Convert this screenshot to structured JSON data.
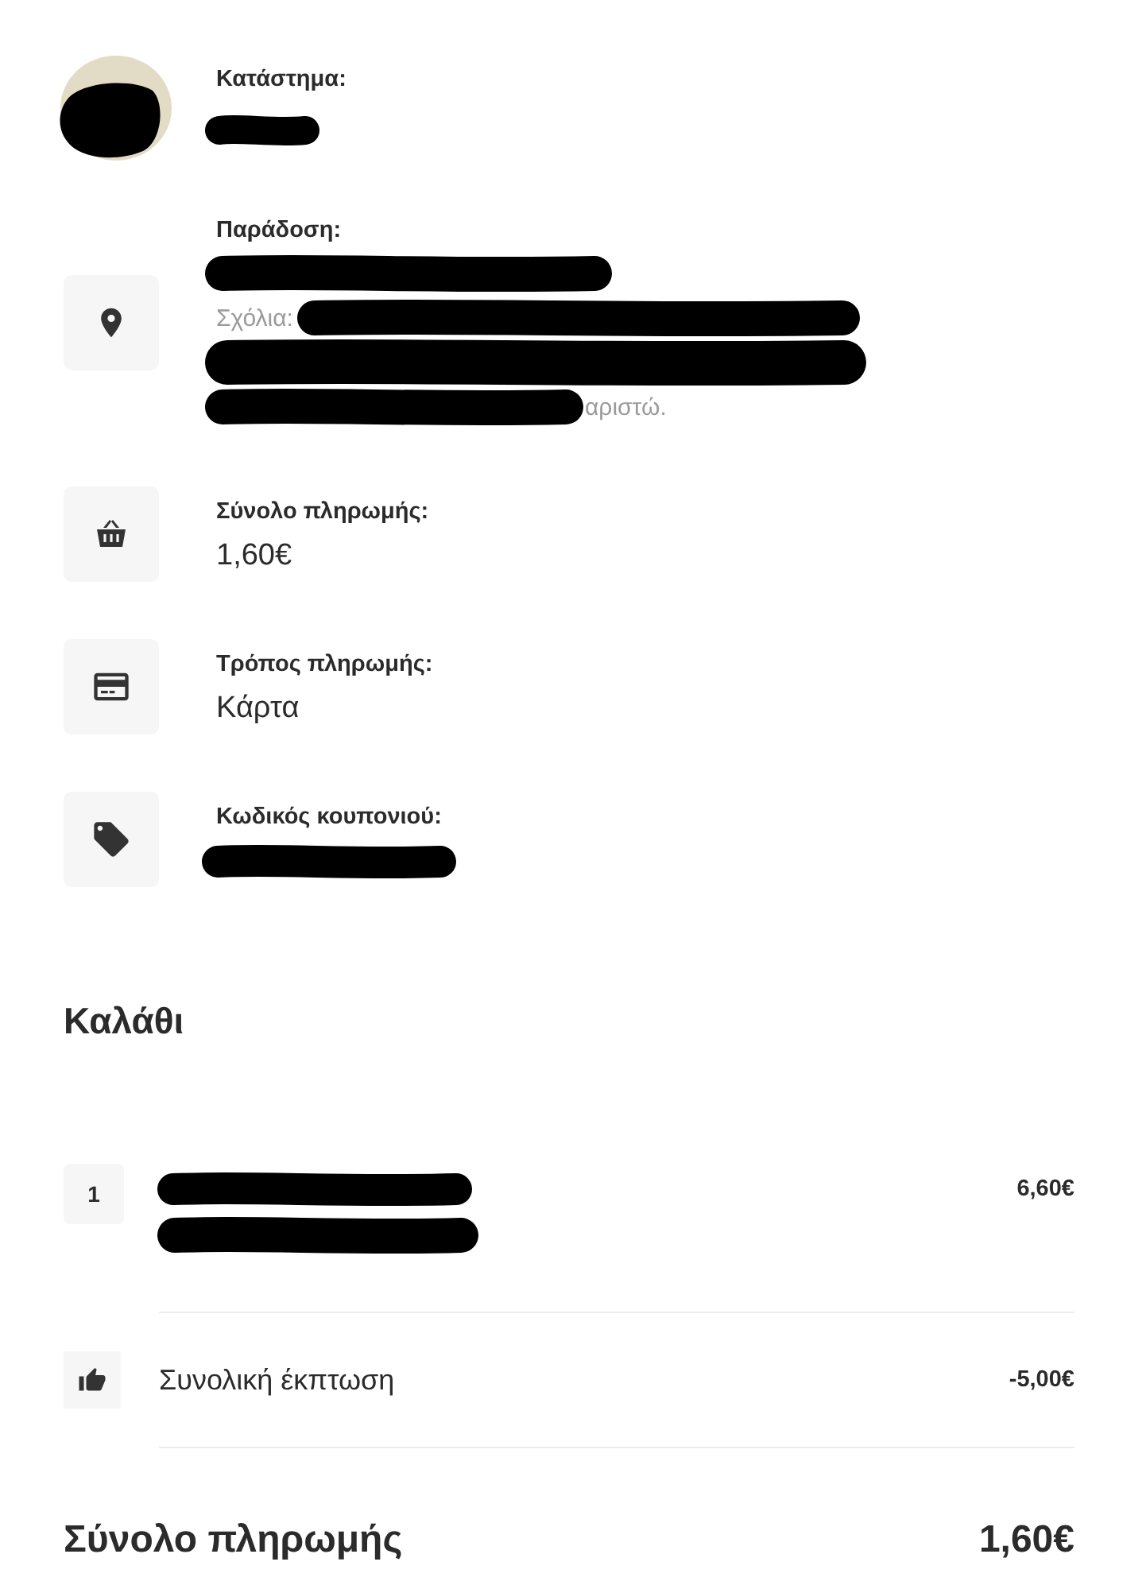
{
  "store": {
    "label": "Κατάστημα:"
  },
  "delivery": {
    "label": "Παράδοση:",
    "comments_label": "Σχόλια:",
    "comments_tail": "αριστώ."
  },
  "info_rows": [
    {
      "kind": "basket",
      "label": "Σύνολο πληρωμής:",
      "value": "1,60€"
    },
    {
      "kind": "card",
      "label": "Τρόπος πληρωμής:",
      "value": "Κάρτα"
    },
    {
      "kind": "tag",
      "label": "Κωδικός κουπονιού:"
    }
  ],
  "cart": {
    "title": "Καλάθι",
    "items": [
      {
        "quantity": "1",
        "price": "6,60€"
      }
    ],
    "discount": {
      "label": "Συνολική έκπτωση",
      "amount": "-5,00€"
    },
    "total": {
      "label": "Σύνολο πληρωμής",
      "amount": "1,60€"
    }
  }
}
